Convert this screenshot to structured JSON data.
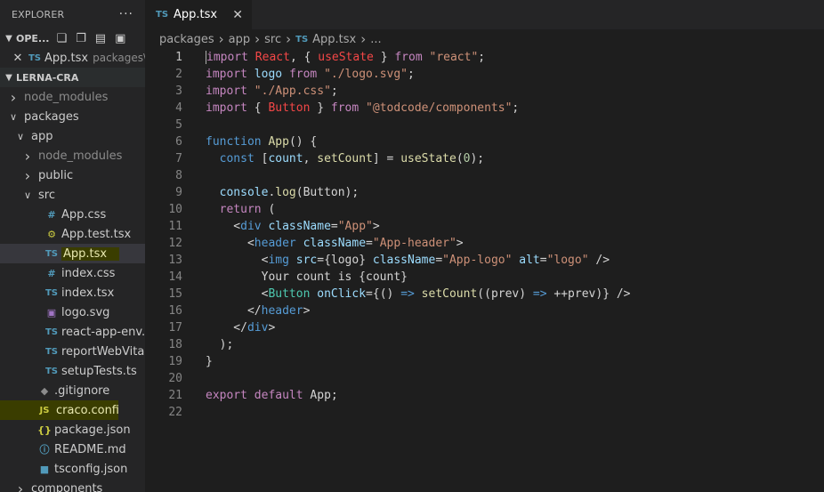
{
  "explorer": {
    "title": "EXPLORER",
    "more": "···",
    "open_editors": {
      "label": "OPE...",
      "file": {
        "name": "App.tsx",
        "path": "packages\\..."
      }
    },
    "workspace": {
      "label": "LERNA-CRA"
    },
    "tree": [
      {
        "name": "node_modules",
        "depth": 0,
        "kind": "folder",
        "expanded": false,
        "dim": true
      },
      {
        "name": "packages",
        "depth": 0,
        "kind": "folder",
        "expanded": true
      },
      {
        "name": "app",
        "depth": 1,
        "kind": "folder",
        "expanded": true
      },
      {
        "name": "node_modules",
        "depth": 2,
        "kind": "folder",
        "expanded": false,
        "dim": true
      },
      {
        "name": "public",
        "depth": 2,
        "kind": "folder",
        "expanded": false
      },
      {
        "name": "src",
        "depth": 2,
        "kind": "folder",
        "expanded": true
      },
      {
        "name": "App.css",
        "depth": 3,
        "kind": "css"
      },
      {
        "name": "App.test.tsx",
        "depth": 3,
        "kind": "test"
      },
      {
        "name": "App.tsx",
        "depth": 3,
        "kind": "ts",
        "selected": true,
        "highlight": true
      },
      {
        "name": "index.css",
        "depth": 3,
        "kind": "css"
      },
      {
        "name": "index.tsx",
        "depth": 3,
        "kind": "ts"
      },
      {
        "name": "logo.svg",
        "depth": 3,
        "kind": "svg"
      },
      {
        "name": "react-app-env.d.ts",
        "depth": 3,
        "kind": "ts"
      },
      {
        "name": "reportWebVitals.ts",
        "depth": 3,
        "kind": "ts"
      },
      {
        "name": "setupTests.ts",
        "depth": 3,
        "kind": "ts"
      },
      {
        "name": ".gitignore",
        "depth": 2,
        "kind": "git"
      },
      {
        "name": "craco.config.js",
        "depth": 2,
        "kind": "js",
        "highlight": true
      },
      {
        "name": "package.json",
        "depth": 2,
        "kind": "json"
      },
      {
        "name": "README.md",
        "depth": 2,
        "kind": "info"
      },
      {
        "name": "tsconfig.json",
        "depth": 2,
        "kind": "tsconf"
      },
      {
        "name": "components",
        "depth": 1,
        "kind": "folder",
        "expanded": false
      }
    ]
  },
  "tab": {
    "label": "App.tsx",
    "icon": "TS",
    "close": "✕"
  },
  "breadcrumb": [
    "packages",
    "app",
    "src",
    "App.tsx",
    "..."
  ],
  "code": {
    "active_line": 1,
    "lines": [
      [
        [
          "kw",
          "import"
        ],
        [
          "",
          "",
          ""
        ],
        [
          "plain",
          " "
        ],
        [
          "react",
          "React"
        ],
        [
          "plain",
          ", { "
        ],
        [
          "react",
          "useState"
        ],
        [
          "plain",
          " } "
        ],
        [
          "kw",
          "from"
        ],
        [
          "plain",
          " "
        ],
        [
          "str",
          "\"react\""
        ],
        [
          "plain",
          ";"
        ]
      ],
      [
        [
          "kw",
          "import"
        ],
        [
          "plain",
          " "
        ],
        [
          "var",
          "logo"
        ],
        [
          "plain",
          " "
        ],
        [
          "kw",
          "from"
        ],
        [
          "plain",
          " "
        ],
        [
          "str",
          "\"./logo.svg\""
        ],
        [
          "plain",
          ";"
        ]
      ],
      [
        [
          "kw",
          "import"
        ],
        [
          "plain",
          " "
        ],
        [
          "str",
          "\"./App.css\""
        ],
        [
          "plain",
          ";"
        ]
      ],
      [
        [
          "kw",
          "import"
        ],
        [
          "plain",
          " { "
        ],
        [
          "react",
          "Button"
        ],
        [
          "plain",
          " } "
        ],
        [
          "kw",
          "from"
        ],
        [
          "plain",
          " "
        ],
        [
          "str",
          "\"@todcode/components\""
        ],
        [
          "plain",
          ";"
        ]
      ],
      [],
      [
        [
          "kw2",
          "function"
        ],
        [
          "plain",
          " "
        ],
        [
          "fn",
          "App"
        ],
        [
          "plain",
          "() {"
        ]
      ],
      [
        [
          "plain",
          "  "
        ],
        [
          "kw2",
          "const"
        ],
        [
          "plain",
          " ["
        ],
        [
          "var",
          "count"
        ],
        [
          "plain",
          ", "
        ],
        [
          "fn",
          "setCount"
        ],
        [
          "plain",
          "] = "
        ],
        [
          "fn",
          "useState"
        ],
        [
          "plain",
          "("
        ],
        [
          "num",
          "0"
        ],
        [
          "plain",
          ");"
        ]
      ],
      [],
      [
        [
          "plain",
          "  "
        ],
        [
          "var",
          "console"
        ],
        [
          "plain",
          "."
        ],
        [
          "fn",
          "log"
        ],
        [
          "plain",
          "(Button);"
        ]
      ],
      [
        [
          "plain",
          "  "
        ],
        [
          "kw",
          "return"
        ],
        [
          "plain",
          " ("
        ]
      ],
      [
        [
          "plain",
          "    <"
        ],
        [
          "tag",
          "div"
        ],
        [
          "plain",
          " "
        ],
        [
          "attr",
          "className"
        ],
        [
          "plain",
          "="
        ],
        [
          "str",
          "\"App\""
        ],
        [
          "plain",
          ">"
        ]
      ],
      [
        [
          "plain",
          "      <"
        ],
        [
          "tag",
          "header"
        ],
        [
          "plain",
          " "
        ],
        [
          "attr",
          "className"
        ],
        [
          "plain",
          "="
        ],
        [
          "str",
          "\"App-header\""
        ],
        [
          "plain",
          ">"
        ]
      ],
      [
        [
          "plain",
          "        <"
        ],
        [
          "tag",
          "img"
        ],
        [
          "plain",
          " "
        ],
        [
          "attr",
          "src"
        ],
        [
          "plain",
          "={logo} "
        ],
        [
          "attr",
          "className"
        ],
        [
          "plain",
          "="
        ],
        [
          "str",
          "\"App-logo\""
        ],
        [
          "plain",
          " "
        ],
        [
          "attr",
          "alt"
        ],
        [
          "plain",
          "="
        ],
        [
          "str",
          "\"logo\""
        ],
        [
          "plain",
          " />"
        ]
      ],
      [
        [
          "plain",
          "        Your count is {count}"
        ]
      ],
      [
        [
          "plain",
          "        <"
        ],
        [
          "cls",
          "Button"
        ],
        [
          "plain",
          " "
        ],
        [
          "attr",
          "onClick"
        ],
        [
          "plain",
          "={() "
        ],
        [
          "kw2",
          "=>"
        ],
        [
          "plain",
          " "
        ],
        [
          "fn",
          "setCount"
        ],
        [
          "plain",
          "((prev) "
        ],
        [
          "kw2",
          "=>"
        ],
        [
          "plain",
          " ++prev)} />"
        ]
      ],
      [
        [
          "plain",
          "      </"
        ],
        [
          "tag",
          "header"
        ],
        [
          "plain",
          ">"
        ]
      ],
      [
        [
          "plain",
          "    </"
        ],
        [
          "tag",
          "div"
        ],
        [
          "plain",
          ">"
        ]
      ],
      [
        [
          "plain",
          "  );"
        ]
      ],
      [
        [
          "plain",
          "}"
        ]
      ],
      [],
      [
        [
          "kw",
          "export"
        ],
        [
          "plain",
          " "
        ],
        [
          "kw",
          "default"
        ],
        [
          "plain",
          " App;"
        ]
      ],
      []
    ]
  }
}
